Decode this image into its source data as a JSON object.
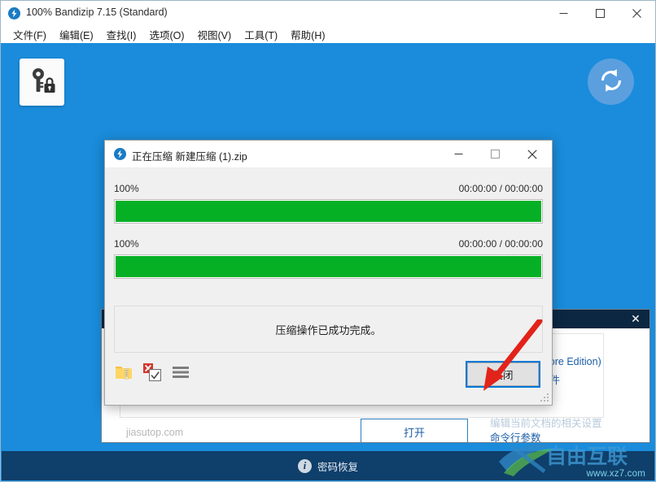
{
  "app": {
    "title": "100% Bandizip 7.15 (Standard)",
    "icon": "bandizip-logo-icon",
    "window_controls": {
      "minimize": "—",
      "maximize": "□",
      "close": "✕"
    },
    "menu": [
      {
        "label": "文件(F)",
        "name": "menu-file"
      },
      {
        "label": "编辑(E)",
        "name": "menu-edit"
      },
      {
        "label": "查找(I)",
        "name": "menu-find"
      },
      {
        "label": "选项(O)",
        "name": "menu-options"
      },
      {
        "label": "视图(V)",
        "name": "menu-view"
      },
      {
        "label": "工具(T)",
        "name": "menu-tools"
      },
      {
        "label": "帮助(H)",
        "name": "menu-help"
      }
    ],
    "canvas": {
      "background_color": "#1a8cdb",
      "keylock_tile_icon": "key-lock-icon",
      "refresh_button_icon": "refresh-icon"
    },
    "statusbar": {
      "background_color": "#0f3f6b",
      "info_icon": "info-icon",
      "label": "密码恢复"
    },
    "watermark": {
      "brand": "自由互联",
      "url": "www.xz7.com"
    }
  },
  "background_window": {
    "titlebar_color": "#0b2742",
    "close_label": "✕",
    "edition_text": "Store Edition)",
    "file_link": "文件",
    "site_text": "jiasutop.com",
    "open_button": "打开",
    "cmd_faded_text": "编辑当前文档的相关设置",
    "cmd_link": "命令行参数"
  },
  "dialog": {
    "icon": "bandizip-logo-icon",
    "title": "正在压缩 新建压缩 (1).zip",
    "window_controls": {
      "minimize": "—",
      "maximize": "□",
      "close": "✕"
    },
    "progress": [
      {
        "name": "overall-progress",
        "percent_label": "100%",
        "time_label": "00:00:00 / 00:00:00",
        "value": 100,
        "fill_color": "#06b025"
      },
      {
        "name": "current-file-progress",
        "percent_label": "100%",
        "time_label": "00:00:00 / 00:00:00",
        "value": 100,
        "fill_color": "#06b025"
      }
    ],
    "message": "压缩操作已成功完成。",
    "footer_icons": [
      {
        "name": "open-folder-icon",
        "label": "打开文件夹"
      },
      {
        "name": "close-on-finish-checkbox-icon",
        "label": "完成后关闭"
      },
      {
        "name": "menu-hamburger-icon",
        "label": "更多"
      }
    ],
    "close_button": "关闭",
    "focus_ring_color": "#0078d7",
    "resize_grip": "resize-grip-icon"
  },
  "annotation": {
    "arrow_color": "#e2231a",
    "points_to": "close-button"
  }
}
